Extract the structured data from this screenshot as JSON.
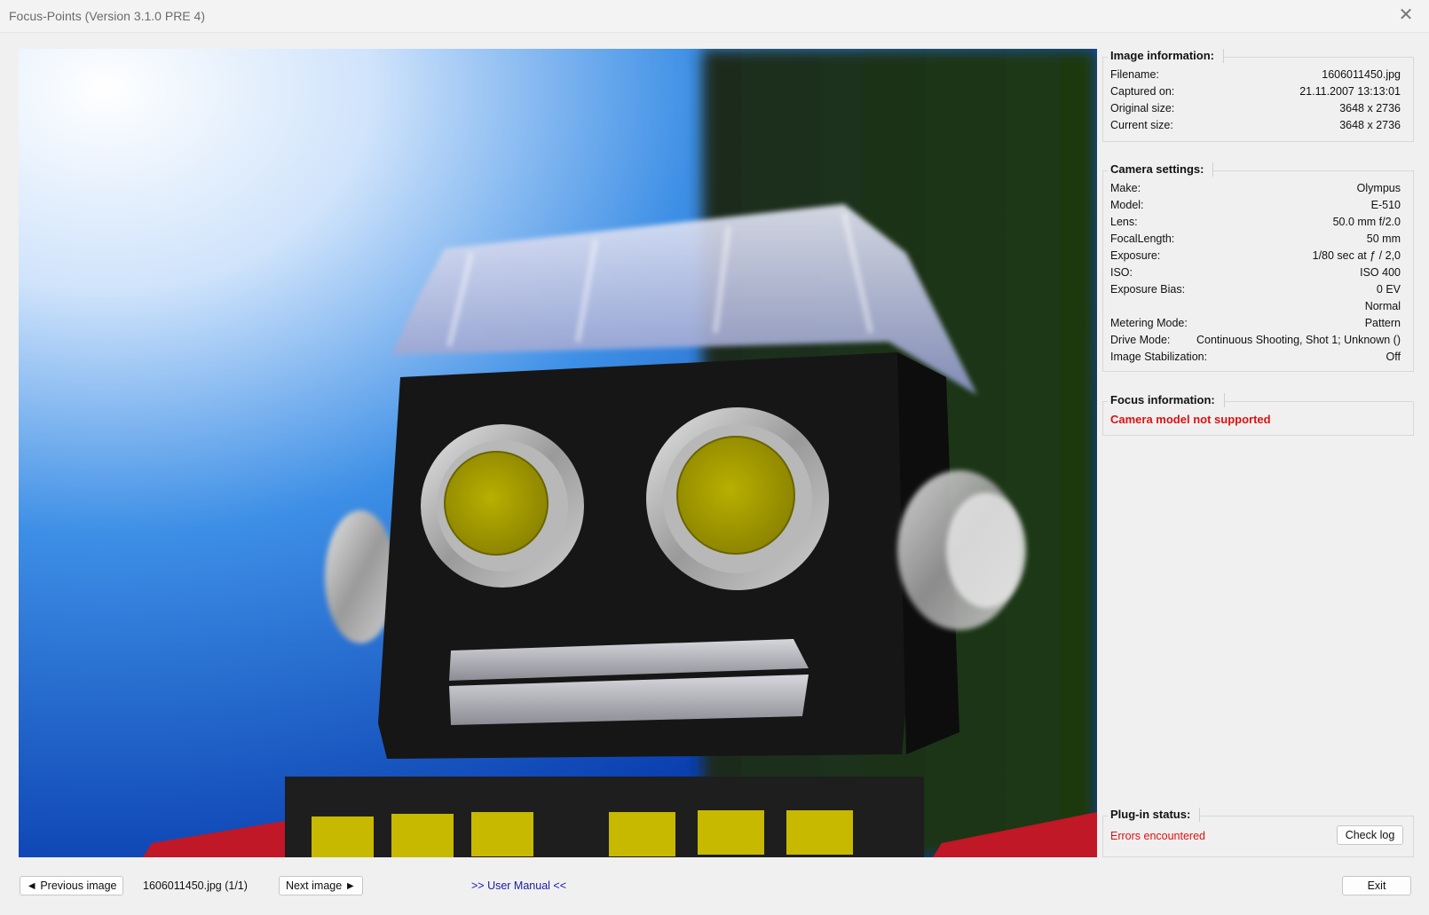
{
  "window": {
    "title": "Focus-Points (Version 3.1.0 PRE 4)",
    "close_glyph": "✕"
  },
  "image_info": {
    "legend": "Image information:",
    "rows": [
      {
        "label": "Filename:",
        "value": "1606011450.jpg"
      },
      {
        "label": "Captured on:",
        "value": "21.11.2007 13:13:01"
      },
      {
        "label": "Original size:",
        "value": "3648 x 2736"
      },
      {
        "label": "Current size:",
        "value": "3648 x 2736"
      }
    ]
  },
  "camera_settings": {
    "legend": "Camera settings:",
    "rows": [
      {
        "label": "Make:",
        "value": "Olympus"
      },
      {
        "label": "Model:",
        "value": "E-510"
      },
      {
        "label": "Lens:",
        "value": "50.0 mm f/2.0"
      },
      {
        "label": "FocalLength:",
        "value": "50 mm"
      },
      {
        "label": "Exposure:",
        "value": "1/80 sec at ƒ / 2,0"
      },
      {
        "label": "ISO:",
        "value": "ISO 400"
      },
      {
        "label": "Exposure Bias:",
        "value": "0 EV"
      },
      {
        "label": "",
        "value": "Normal"
      },
      {
        "label": "Metering Mode:",
        "value": "Pattern"
      },
      {
        "label": "Drive Mode:",
        "value": "Continuous Shooting, Shot 1; Unknown ()"
      },
      {
        "label": "Image Stabilization:",
        "value": "Off"
      }
    ]
  },
  "focus_info": {
    "legend": "Focus information:",
    "message": "Camera model not supported"
  },
  "plugin_status": {
    "legend": "Plug-in status:",
    "status": "Errors encountered",
    "check_log_label": "Check log"
  },
  "footer": {
    "prev_label": "◄ Previous image",
    "current_file": "1606011450.jpg (1/1)",
    "next_label": "Next image ►",
    "manual_label": ">> User Manual <<",
    "exit_label": "Exit"
  },
  "photo": {
    "subject": "toy robot head close-up",
    "colors": {
      "accent_error": "#dd1111",
      "link": "#1a1aa6"
    }
  }
}
